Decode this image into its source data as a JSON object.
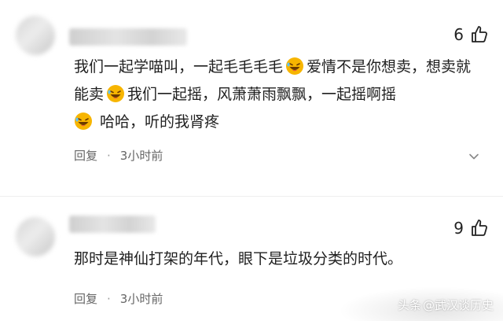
{
  "comments": [
    {
      "likes": "6",
      "text_parts": [
        "我们一起学喵叫，一起毛毛毛毛",
        "爱情不是你想卖，想卖就能卖",
        "我们一起摇，风萧萧雨飘飘，一起摇啊摇",
        "哈哈，听的我肾疼"
      ],
      "reply_label": "回复",
      "separator": "·",
      "time": "3小时前"
    },
    {
      "likes": "9",
      "text": "那时是神仙打架的年代，眼下是垃圾分类的时代。",
      "reply_label": "回复",
      "separator": "·",
      "time": "3小时前"
    }
  ],
  "watermark": {
    "brand": "头条",
    "handle": "@武汉谈历史"
  },
  "colors": {
    "text": "#1f1f1f",
    "meta": "#666666",
    "emoji_face": "#f7b500",
    "emoji_tongue": "#e8454a"
  },
  "icons": [
    "avatar",
    "thumbs-up-icon",
    "laughing-emoji-icon",
    "chevron-down-icon"
  ]
}
